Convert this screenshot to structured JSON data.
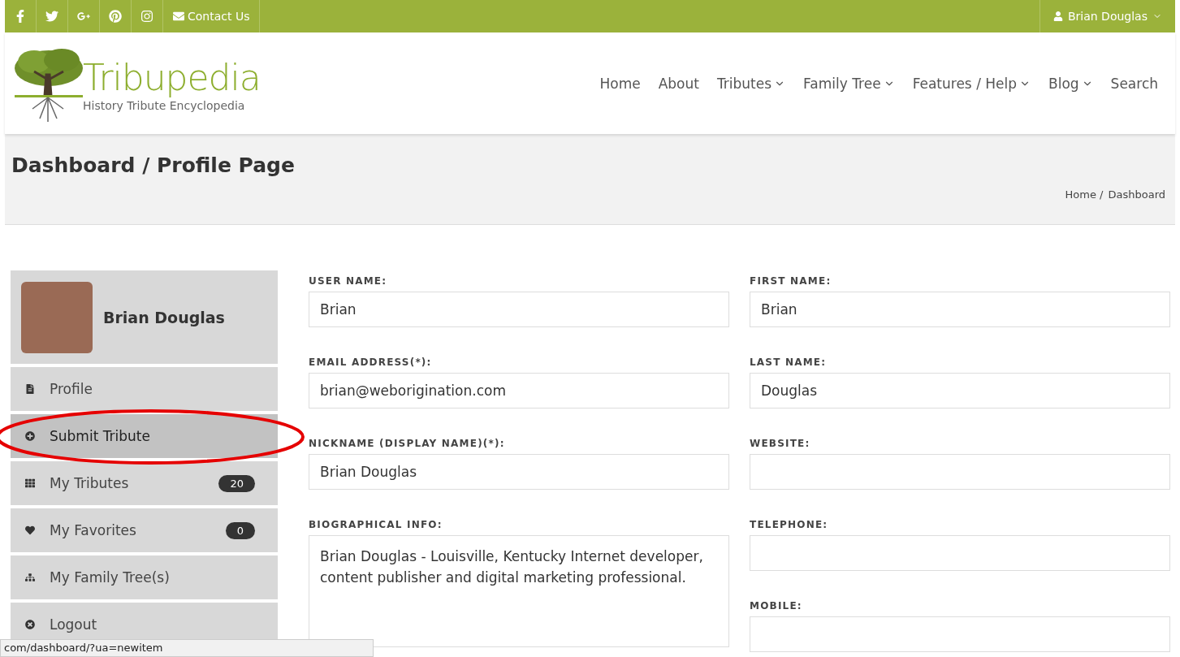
{
  "top_bar": {
    "social": [
      {
        "kind": "facebook"
      },
      {
        "kind": "twitter"
      },
      {
        "kind": "googleplus"
      },
      {
        "kind": "pinterest"
      },
      {
        "kind": "instagram"
      }
    ],
    "contact": "Contact Us",
    "user": "Brian Douglas"
  },
  "logo": {
    "name": "Tribupedia",
    "tagline": "History Tribute Encyclopedia"
  },
  "nav": [
    {
      "label": "Home",
      "dropdown": false
    },
    {
      "label": "About",
      "dropdown": false
    },
    {
      "label": "Tributes",
      "dropdown": true
    },
    {
      "label": "Family Tree",
      "dropdown": true
    },
    {
      "label": "Features / Help",
      "dropdown": true
    },
    {
      "label": "Blog",
      "dropdown": true
    },
    {
      "label": "Search",
      "dropdown": false
    }
  ],
  "page_title": "Dashboard / Profile Page",
  "breadcrumb": [
    "Home /",
    "Dashboard"
  ],
  "sidebar": {
    "profile_name": "Brian Douglas",
    "items": [
      {
        "kind": "profile",
        "label": "Profile",
        "selected": false
      },
      {
        "kind": "submit",
        "label": "Submit Tribute",
        "selected": true
      },
      {
        "kind": "tributes",
        "label": "My Tributes",
        "badge": "20",
        "selected": false
      },
      {
        "kind": "favorites",
        "label": "My Favorites",
        "badge": "0",
        "selected": false
      },
      {
        "kind": "tree",
        "label": "My Family Tree(s)",
        "selected": false
      },
      {
        "kind": "logout",
        "label": "Logout",
        "selected": false
      }
    ]
  },
  "form": {
    "left": [
      {
        "label": "USER NAME:",
        "value": "Brian",
        "kind": "input"
      },
      {
        "label": "EMAIL ADDRESS(*):",
        "value": "brian@weborigination.com",
        "kind": "input"
      },
      {
        "label": "NICKNAME (DISPLAY NAME)(*):",
        "value": "Brian Douglas",
        "kind": "input"
      },
      {
        "label": "BIOGRAPHICAL INFO:",
        "value": "Brian Douglas - Louisville, Kentucky Internet developer, content publisher and digital marketing professional.",
        "kind": "textarea"
      }
    ],
    "right": [
      {
        "label": "FIRST NAME:",
        "value": "Brian",
        "kind": "input"
      },
      {
        "label": "LAST NAME:",
        "value": "Douglas",
        "kind": "input"
      },
      {
        "label": "WEBSITE:",
        "kind": "input"
      },
      {
        "label": "TELEPHONE:",
        "kind": "input"
      },
      {
        "label": "MOBILE:",
        "kind": "input"
      }
    ]
  },
  "status_bar": "com/dashboard/?ua=newitem"
}
